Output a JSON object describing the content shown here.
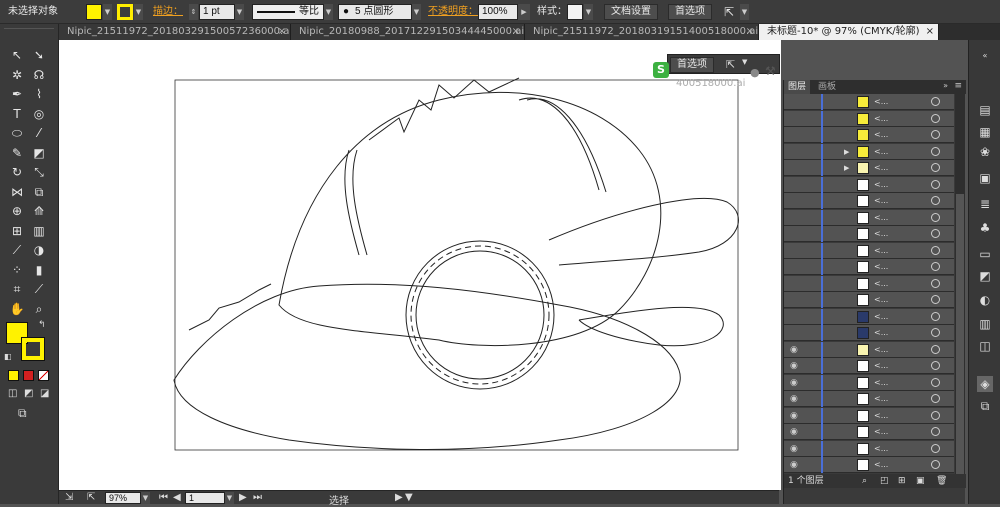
{
  "control_bar": {
    "selection": "未选择对象",
    "fill_color": "#fff200",
    "stroke_color": "#ffed00",
    "stroke_label": "描边：",
    "stroke_weight": "1 pt",
    "brush_profile": "等比",
    "brush_point": "5 点圆形",
    "opacity_label": "不透明度：",
    "opacity_value": "100%",
    "style_label": "样式：",
    "doc_settings": "文档设置",
    "prefs": "首选项"
  },
  "doc_tabs": [
    {
      "title": "Nipic_21511972_20180329150057236000.ai*"
    },
    {
      "title": "Nipic_20180988_20171229150344445000.ai*"
    },
    {
      "title": "Nipic_21511972_20180319151400518000.ai*"
    },
    {
      "title": "未标题-10* @ 97% (CMYK/轮廓)"
    }
  ],
  "tools": [
    {
      "icon": "selection-tool-icon",
      "glyph": "↖"
    },
    {
      "icon": "direct-selection-tool-icon",
      "glyph": "➘"
    },
    {
      "icon": "magic-wand-tool-icon",
      "glyph": "✲"
    },
    {
      "icon": "lasso-tool-icon",
      "glyph": "☊"
    },
    {
      "icon": "pen-tool-icon",
      "glyph": "✒"
    },
    {
      "icon": "curvature-tool-icon",
      "glyph": "⌇"
    },
    {
      "icon": "type-tool-icon",
      "glyph": "T"
    },
    {
      "icon": "spiral-tool-icon",
      "glyph": "◎"
    },
    {
      "icon": "ellipse-tool-icon",
      "glyph": "⬭"
    },
    {
      "icon": "paintbrush-tool-icon",
      "glyph": "⁄"
    },
    {
      "icon": "pencil-tool-icon",
      "glyph": "✎"
    },
    {
      "icon": "eraser-tool-icon",
      "glyph": "◩"
    },
    {
      "icon": "rotate-tool-icon",
      "glyph": "↻"
    },
    {
      "icon": "scale-tool-icon",
      "glyph": "⤡"
    },
    {
      "icon": "width-tool-icon",
      "glyph": "⋈"
    },
    {
      "icon": "free-transform-tool-icon",
      "glyph": "⧉"
    },
    {
      "icon": "shape-builder-tool-icon",
      "glyph": "⊕"
    },
    {
      "icon": "perspective-grid-tool-icon",
      "glyph": "⟰"
    },
    {
      "icon": "mesh-tool-icon",
      "glyph": "⊞"
    },
    {
      "icon": "gradient-tool-icon",
      "glyph": "▥"
    },
    {
      "icon": "eyedropper-tool-icon",
      "glyph": "⟋"
    },
    {
      "icon": "blend-tool-icon",
      "glyph": "◑"
    },
    {
      "icon": "symbol-sprayer-tool-icon",
      "glyph": "⁘"
    },
    {
      "icon": "column-graph-tool-icon",
      "glyph": "▮"
    },
    {
      "icon": "artboard-tool-icon",
      "glyph": "⌗"
    },
    {
      "icon": "slice-tool-icon",
      "glyph": "⟋"
    },
    {
      "icon": "hand-tool-icon",
      "glyph": "✋"
    },
    {
      "icon": "zoom-tool-icon",
      "glyph": "⌕"
    }
  ],
  "layers_panel": {
    "tab_layers": "图层",
    "tab_artboards": "画板",
    "footer": "1 个图层",
    "rows": [
      {
        "eye": "",
        "arrow": "",
        "thumb": "#f7ec3a"
      },
      {
        "eye": "",
        "arrow": "",
        "thumb": "#f7ec3a"
      },
      {
        "eye": "",
        "arrow": "",
        "thumb": "#f7ec3a"
      },
      {
        "eye": "",
        "arrow": "▶",
        "thumb": "#f7ec3a"
      },
      {
        "eye": "",
        "arrow": "▶",
        "thumb": "#f9f4b0"
      },
      {
        "eye": "",
        "arrow": "",
        "thumb": "#ffffff"
      },
      {
        "eye": "",
        "arrow": "",
        "thumb": "#ffffff"
      },
      {
        "eye": "",
        "arrow": "",
        "thumb": "#ffffff"
      },
      {
        "eye": "",
        "arrow": "",
        "thumb": "#ffffff"
      },
      {
        "eye": "",
        "arrow": "",
        "thumb": "#ffffff"
      },
      {
        "eye": "",
        "arrow": "",
        "thumb": "#ffffff"
      },
      {
        "eye": "",
        "arrow": "",
        "thumb": "#ffffff"
      },
      {
        "eye": "",
        "arrow": "",
        "thumb": "#ffffff"
      },
      {
        "eye": "",
        "arrow": "",
        "thumb": "#2a3a6a"
      },
      {
        "eye": "",
        "arrow": "",
        "thumb": "#2a3a6a"
      },
      {
        "eye": "◉",
        "arrow": "",
        "thumb": "#f9f4b0"
      },
      {
        "eye": "◉",
        "arrow": "",
        "thumb": "#ffffff"
      },
      {
        "eye": "◉",
        "arrow": "",
        "thumb": "#ffffff"
      },
      {
        "eye": "◉",
        "arrow": "",
        "thumb": "#ffffff"
      },
      {
        "eye": "◉",
        "arrow": "",
        "thumb": "#ffffff"
      },
      {
        "eye": "◉",
        "arrow": "",
        "thumb": "#ffffff"
      },
      {
        "eye": "◉",
        "arrow": "",
        "thumb": "#ffffff"
      },
      {
        "eye": "◉",
        "arrow": "",
        "thumb": "#ffffff"
      }
    ]
  },
  "floating": {
    "prefs": "首选项",
    "doc_fragment": "400518000.ai"
  },
  "status": {
    "zoom": "97%",
    "page": "1",
    "tool": "选择"
  }
}
